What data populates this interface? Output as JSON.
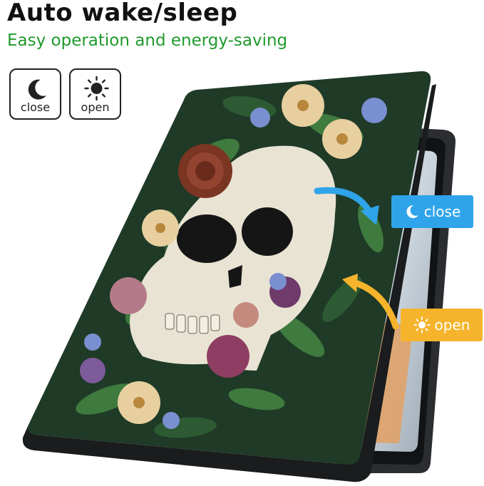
{
  "header": {
    "title": "Auto wake/sleep",
    "subtitle": "Easy operation and energy-saving"
  },
  "modes": [
    {
      "label": "close",
      "icon": "moon-icon"
    },
    {
      "label": "open",
      "icon": "sun-icon"
    }
  ],
  "callouts": {
    "close": {
      "label": "close",
      "icon": "moon-icon",
      "color": "#2fa4ea"
    },
    "open": {
      "label": "open",
      "icon": "sun-icon",
      "color": "#f6b42c"
    }
  },
  "colors": {
    "headline": "#111111",
    "subtitle": "#1f9a2c",
    "cover_green": "#1f3a27",
    "skull": "#e9e3d3"
  }
}
